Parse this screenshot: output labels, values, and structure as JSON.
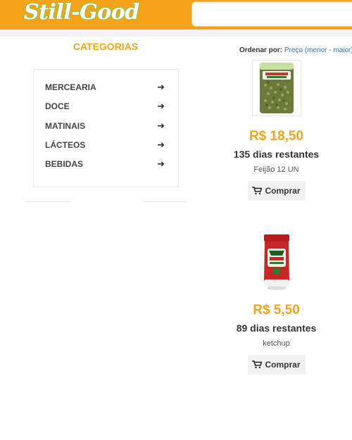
{
  "header": {
    "logo_text": "Still-Good",
    "search": {
      "placeholder": ""
    },
    "colors": {
      "brand": "#f7a21b",
      "logo_outline": "#8cc63f"
    }
  },
  "sidebar": {
    "title": "CATEGORIAS",
    "items": [
      {
        "label": "MERCEARIA",
        "icon": "arrow-right-icon"
      },
      {
        "label": "DOCE",
        "icon": "arrow-right-icon"
      },
      {
        "label": "MATINAIS",
        "icon": "arrow-right-icon"
      },
      {
        "label": "LÁCTEOS",
        "icon": "arrow-right-icon"
      },
      {
        "label": "BEBIDAS",
        "icon": "arrow-right-icon"
      }
    ]
  },
  "sort": {
    "label": "Ordenar por:",
    "value": "Preço (menor - maior) | M"
  },
  "products": [
    {
      "price": "R$ 18,50",
      "days": "135 dias restantes",
      "name": "Feijão 12 UN",
      "buy_label": "Comprar",
      "image": "feijao-bag-image"
    },
    {
      "price": "R$ 5,50",
      "days": "89 dias restantes",
      "name": "ketchup",
      "buy_label": "Comprar",
      "image": "ketchup-bottle-image"
    }
  ]
}
